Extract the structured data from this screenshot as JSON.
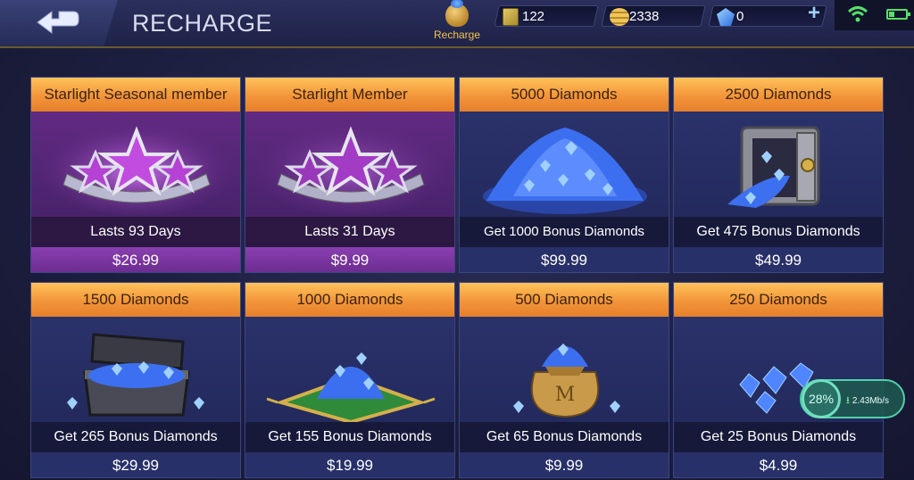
{
  "header": {
    "title": "RECHARGE",
    "recharge_label": "Recharge",
    "tickets": "122",
    "battle_points": "2338",
    "diamonds": "0",
    "plus_label": "+"
  },
  "cards": [
    {
      "title": "Starlight Seasonal member",
      "desc": "Lasts 93 Days",
      "price": "$26.99",
      "art": "starlight-badge"
    },
    {
      "title": "Starlight Member",
      "desc": "Lasts 31 Days",
      "price": "$9.99",
      "art": "starlight-badge"
    },
    {
      "title": "5000 Diamonds",
      "desc": "Get 1000 Bonus Diamonds",
      "price": "$99.99",
      "art": "diamond-pile"
    },
    {
      "title": "2500 Diamonds",
      "desc": "Get 475 Bonus Diamonds",
      "price": "$49.99",
      "art": "diamond-safe"
    },
    {
      "title": "1500 Diamonds",
      "desc": "Get 265 Bonus Diamonds",
      "price": "$29.99",
      "art": "diamond-chest"
    },
    {
      "title": "1000 Diamonds",
      "desc": "Get 155 Bonus Diamonds",
      "price": "$19.99",
      "art": "diamond-carpet"
    },
    {
      "title": "500 Diamonds",
      "desc": "Get 65 Bonus Diamonds",
      "price": "$9.99",
      "art": "diamond-bag"
    },
    {
      "title": "250 Diamonds",
      "desc": "Get 25 Bonus Diamonds",
      "price": "$4.99",
      "art": "diamond-scatter"
    }
  ],
  "download": {
    "percent": "28%",
    "speed": "2.43Mb/s"
  },
  "colors": {
    "header_orange": "#f2953a",
    "purple_card": "#6a2c8a",
    "blue_card": "#2d3570"
  }
}
